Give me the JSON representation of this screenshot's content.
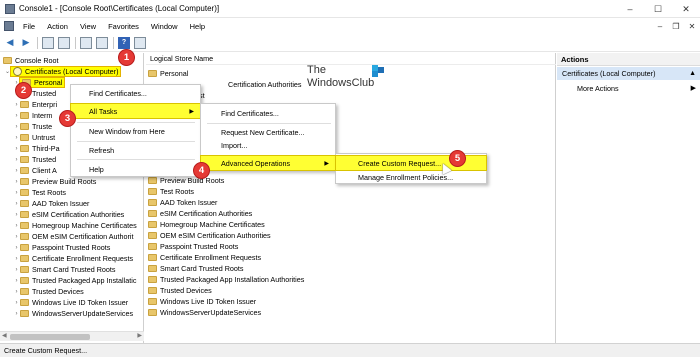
{
  "window": {
    "title": "Console1 - [Console Root\\Certificates (Local Computer)]",
    "controls": [
      "–",
      "☐",
      "✕"
    ]
  },
  "menubar": {
    "items": [
      "File",
      "Action",
      "View",
      "Favorites",
      "Window",
      "Help"
    ],
    "mdi_controls": [
      "–",
      "❐",
      "✕"
    ]
  },
  "toolbar": {
    "buttons": [
      "back-arrow",
      "forward-arrow",
      "up-folder",
      "show-hide-tree",
      "refresh",
      "export-list",
      "help",
      "show-hide-action-pane"
    ]
  },
  "tree": {
    "root": "Console Root",
    "certificates": "Certificates (Local Computer)",
    "personal": "Personal",
    "items_partial": [
      "Trusted",
      "Enterpri",
      "Interm",
      "Truste",
      "Untrust",
      "Third-Pa",
      "Trusted",
      "Client A"
    ],
    "items": [
      "Preview Build Roots",
      "Test Roots",
      "AAD Token Issuer",
      "eSIM Certification Authorities",
      "Homegroup Machine Certificates",
      "OEM eSIM Certification Authorit",
      "Passpoint Trusted Roots",
      "Certificate Enrollment Requests",
      "Smart Card Trusted Roots",
      "Trusted Packaged App Installatic",
      "Trusted Devices",
      "Windows Live ID Token Issuer",
      "WindowsServerUpdateServices"
    ]
  },
  "center": {
    "column_header": "Logical Store Name",
    "partial_rows": [
      "Personal",
      "Certification Authorities",
      "st"
    ],
    "rows": [
      "Preview Build Roots",
      "Test Roots",
      "AAD Token Issuer",
      "eSIM Certification Authorities",
      "Homegroup Machine Certificates",
      "OEM eSIM Certification Authorities",
      "Passpoint Trusted Roots",
      "Certificate Enrollment Requests",
      "Smart Card Trusted Roots",
      "Trusted Packaged App Installation Authorities",
      "Trusted Devices",
      "Windows Live ID Token Issuer",
      "WindowsServerUpdateServices"
    ]
  },
  "watermark": {
    "line1": "The",
    "line2": "WindowsClub"
  },
  "actions": {
    "header": "Actions",
    "section": "Certificates (Local Computer)",
    "more": "More Actions"
  },
  "context_menu": {
    "items": [
      "Find Certificates...",
      "All Tasks",
      "New Window from Here",
      "Refresh",
      "Help"
    ]
  },
  "all_tasks_menu": {
    "items": [
      "Find Certificates...",
      "Request New Certificate...",
      "Import...",
      "Advanced Operations"
    ]
  },
  "advanced_menu": {
    "items": [
      "Create Custom Request...",
      "Manage Enrollment Policies..."
    ]
  },
  "callouts": [
    "1",
    "2",
    "3",
    "4",
    "5"
  ],
  "status": {
    "text": "Create Custom Request..."
  },
  "colors": {
    "highlight": "#ffff00",
    "callout": "#e53935",
    "action_selected": "#d7e6f7"
  }
}
